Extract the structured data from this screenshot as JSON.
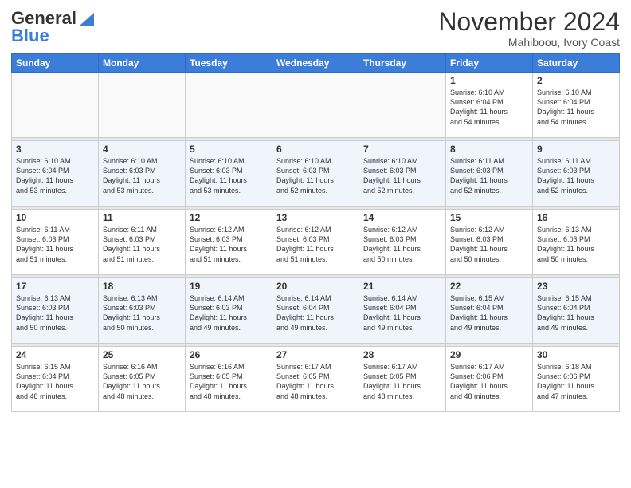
{
  "header": {
    "logo_line1": "General",
    "logo_line2": "Blue",
    "month": "November 2024",
    "location": "Mahiboou, Ivory Coast"
  },
  "days_of_week": [
    "Sunday",
    "Monday",
    "Tuesday",
    "Wednesday",
    "Thursday",
    "Friday",
    "Saturday"
  ],
  "weeks": [
    [
      {
        "day": "",
        "info": ""
      },
      {
        "day": "",
        "info": ""
      },
      {
        "day": "",
        "info": ""
      },
      {
        "day": "",
        "info": ""
      },
      {
        "day": "",
        "info": ""
      },
      {
        "day": "1",
        "info": "Sunrise: 6:10 AM\nSunset: 6:04 PM\nDaylight: 11 hours\nand 54 minutes."
      },
      {
        "day": "2",
        "info": "Sunrise: 6:10 AM\nSunset: 6:04 PM\nDaylight: 11 hours\nand 54 minutes."
      }
    ],
    [
      {
        "day": "3",
        "info": "Sunrise: 6:10 AM\nSunset: 6:04 PM\nDaylight: 11 hours\nand 53 minutes."
      },
      {
        "day": "4",
        "info": "Sunrise: 6:10 AM\nSunset: 6:03 PM\nDaylight: 11 hours\nand 53 minutes."
      },
      {
        "day": "5",
        "info": "Sunrise: 6:10 AM\nSunset: 6:03 PM\nDaylight: 11 hours\nand 53 minutes."
      },
      {
        "day": "6",
        "info": "Sunrise: 6:10 AM\nSunset: 6:03 PM\nDaylight: 11 hours\nand 52 minutes."
      },
      {
        "day": "7",
        "info": "Sunrise: 6:10 AM\nSunset: 6:03 PM\nDaylight: 11 hours\nand 52 minutes."
      },
      {
        "day": "8",
        "info": "Sunrise: 6:11 AM\nSunset: 6:03 PM\nDaylight: 11 hours\nand 52 minutes."
      },
      {
        "day": "9",
        "info": "Sunrise: 6:11 AM\nSunset: 6:03 PM\nDaylight: 11 hours\nand 52 minutes."
      }
    ],
    [
      {
        "day": "10",
        "info": "Sunrise: 6:11 AM\nSunset: 6:03 PM\nDaylight: 11 hours\nand 51 minutes."
      },
      {
        "day": "11",
        "info": "Sunrise: 6:11 AM\nSunset: 6:03 PM\nDaylight: 11 hours\nand 51 minutes."
      },
      {
        "day": "12",
        "info": "Sunrise: 6:12 AM\nSunset: 6:03 PM\nDaylight: 11 hours\nand 51 minutes."
      },
      {
        "day": "13",
        "info": "Sunrise: 6:12 AM\nSunset: 6:03 PM\nDaylight: 11 hours\nand 51 minutes."
      },
      {
        "day": "14",
        "info": "Sunrise: 6:12 AM\nSunset: 6:03 PM\nDaylight: 11 hours\nand 50 minutes."
      },
      {
        "day": "15",
        "info": "Sunrise: 6:12 AM\nSunset: 6:03 PM\nDaylight: 11 hours\nand 50 minutes."
      },
      {
        "day": "16",
        "info": "Sunrise: 6:13 AM\nSunset: 6:03 PM\nDaylight: 11 hours\nand 50 minutes."
      }
    ],
    [
      {
        "day": "17",
        "info": "Sunrise: 6:13 AM\nSunset: 6:03 PM\nDaylight: 11 hours\nand 50 minutes."
      },
      {
        "day": "18",
        "info": "Sunrise: 6:13 AM\nSunset: 6:03 PM\nDaylight: 11 hours\nand 50 minutes."
      },
      {
        "day": "19",
        "info": "Sunrise: 6:14 AM\nSunset: 6:03 PM\nDaylight: 11 hours\nand 49 minutes."
      },
      {
        "day": "20",
        "info": "Sunrise: 6:14 AM\nSunset: 6:04 PM\nDaylight: 11 hours\nand 49 minutes."
      },
      {
        "day": "21",
        "info": "Sunrise: 6:14 AM\nSunset: 6:04 PM\nDaylight: 11 hours\nand 49 minutes."
      },
      {
        "day": "22",
        "info": "Sunrise: 6:15 AM\nSunset: 6:04 PM\nDaylight: 11 hours\nand 49 minutes."
      },
      {
        "day": "23",
        "info": "Sunrise: 6:15 AM\nSunset: 6:04 PM\nDaylight: 11 hours\nand 49 minutes."
      }
    ],
    [
      {
        "day": "24",
        "info": "Sunrise: 6:15 AM\nSunset: 6:04 PM\nDaylight: 11 hours\nand 48 minutes."
      },
      {
        "day": "25",
        "info": "Sunrise: 6:16 AM\nSunset: 6:05 PM\nDaylight: 11 hours\nand 48 minutes."
      },
      {
        "day": "26",
        "info": "Sunrise: 6:16 AM\nSunset: 6:05 PM\nDaylight: 11 hours\nand 48 minutes."
      },
      {
        "day": "27",
        "info": "Sunrise: 6:17 AM\nSunset: 6:05 PM\nDaylight: 11 hours\nand 48 minutes."
      },
      {
        "day": "28",
        "info": "Sunrise: 6:17 AM\nSunset: 6:05 PM\nDaylight: 11 hours\nand 48 minutes."
      },
      {
        "day": "29",
        "info": "Sunrise: 6:17 AM\nSunset: 6:06 PM\nDaylight: 11 hours\nand 48 minutes."
      },
      {
        "day": "30",
        "info": "Sunrise: 6:18 AM\nSunset: 6:06 PM\nDaylight: 11 hours\nand 47 minutes."
      }
    ]
  ]
}
